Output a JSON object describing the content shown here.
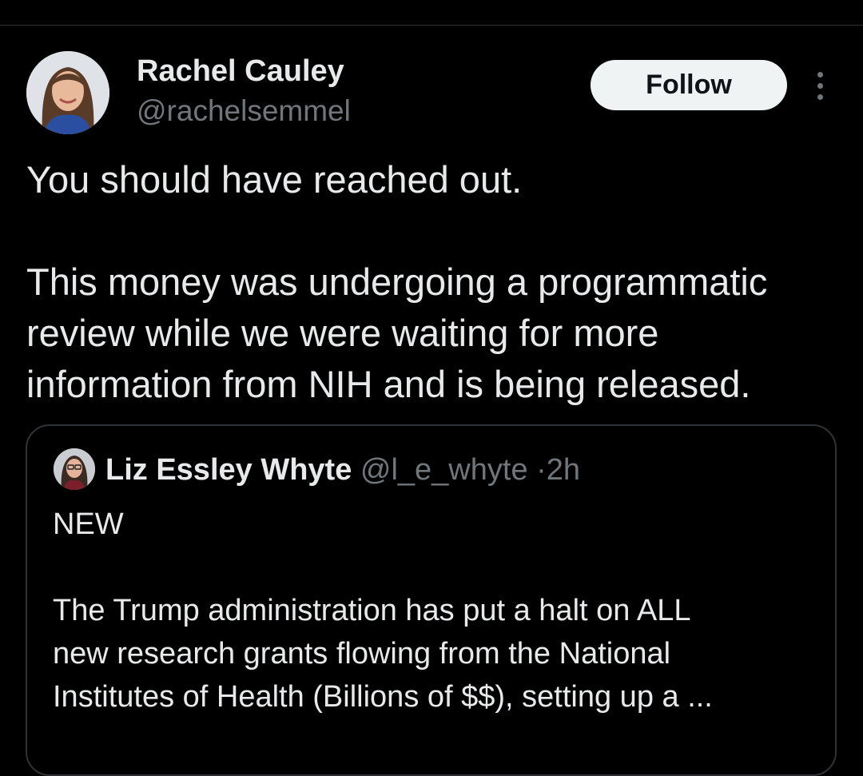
{
  "post": {
    "author": {
      "name": "Rachel Cauley",
      "handle": "@rachelsemmel"
    },
    "follow_label": "Follow",
    "more_icon": "more-vertical-icon",
    "text_lines": [
      "You should have reached out.",
      "",
      "This money was undergoing a programmatic",
      "review while we were waiting for more",
      "information from NIH and is being released."
    ]
  },
  "quote": {
    "author": {
      "name": "Liz Essley Whyte",
      "handle": "@l_e_whyte",
      "separator": "·",
      "time": "2h"
    },
    "text_lines": [
      "NEW",
      "",
      "The Trump administration has put a halt on ALL",
      "new research grants flowing from the National",
      "Institutes of Health (Billions of $$), setting up a ..."
    ]
  },
  "colors": {
    "background": "#000000",
    "text_primary": "#e7e9ea",
    "text_secondary": "#71767b",
    "border": "#2f3336",
    "follow_bg": "#eff3f4"
  }
}
